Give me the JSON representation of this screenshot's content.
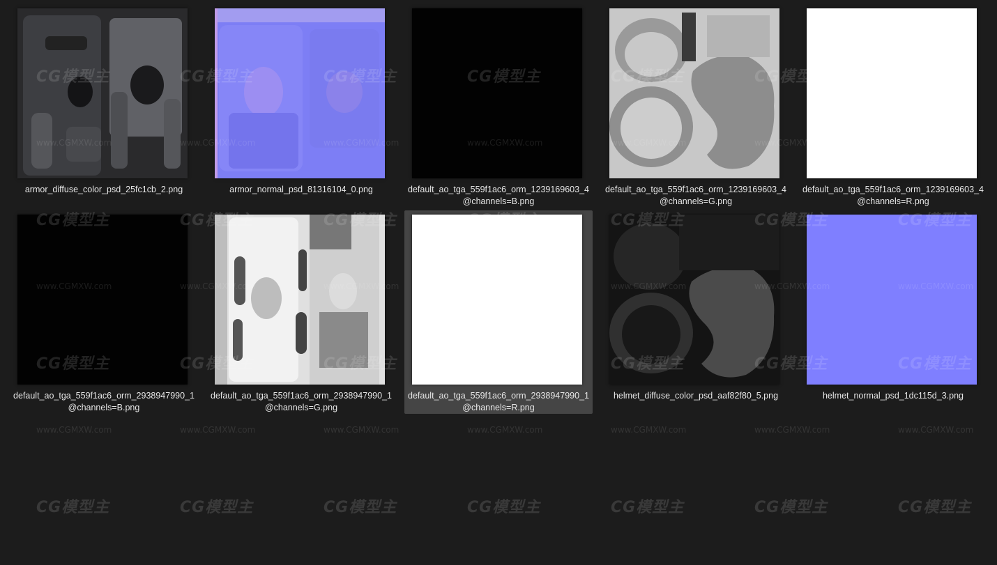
{
  "files": [
    {
      "id": "armor-diffuse",
      "line1": "armor_diffuse_color_psd_25fc1cb_2.png",
      "line2": "",
      "thumb": "armor-diffuse",
      "selected": false
    },
    {
      "id": "armor-normal",
      "line1": "armor_normal_psd_81316104_0.png",
      "line2": "",
      "thumb": "armor-normal",
      "selected": false
    },
    {
      "id": "orm-1239-b",
      "line1": "default_ao_tga_559f1ac6_orm_1239169603_4",
      "line2": "@channels=B.png",
      "thumb": "black",
      "selected": false
    },
    {
      "id": "orm-1239-g",
      "line1": "default_ao_tga_559f1ac6_orm_1239169603_4",
      "line2": "@channels=G.png",
      "thumb": "helmet-gray",
      "selected": false
    },
    {
      "id": "orm-1239-r",
      "line1": "default_ao_tga_559f1ac6_orm_1239169603_4",
      "line2": "@channels=R.png",
      "thumb": "white",
      "selected": false
    },
    {
      "id": "orm-2938-b",
      "line1": "default_ao_tga_559f1ac6_orm_2938947990_1",
      "line2": "@channels=B.png",
      "thumb": "black",
      "selected": false
    },
    {
      "id": "orm-2938-g",
      "line1": "default_ao_tga_559f1ac6_orm_2938947990_1",
      "line2": "@channels=G.png",
      "thumb": "armor-ao",
      "selected": false
    },
    {
      "id": "orm-2938-r",
      "line1": "default_ao_tga_559f1ac6_orm_2938947990_1",
      "line2": "@channels=R.png",
      "thumb": "white",
      "selected": true
    },
    {
      "id": "helmet-diffuse",
      "line1": "helmet_diffuse_color_psd_aaf82f80_5.png",
      "line2": "",
      "thumb": "helmet-dark",
      "selected": false
    },
    {
      "id": "helmet-normal",
      "line1": "helmet_normal_psd_1dc115d_3.png",
      "line2": "",
      "thumb": "flat-normal",
      "selected": false
    }
  ],
  "watermark": {
    "logo": "CG模型主",
    "url": "www.CGMXW.com"
  },
  "colors": {
    "background": "#1c1c1c",
    "selection": "#454545",
    "normal_map": "#7f7fff",
    "label": "#e6e6e6"
  }
}
